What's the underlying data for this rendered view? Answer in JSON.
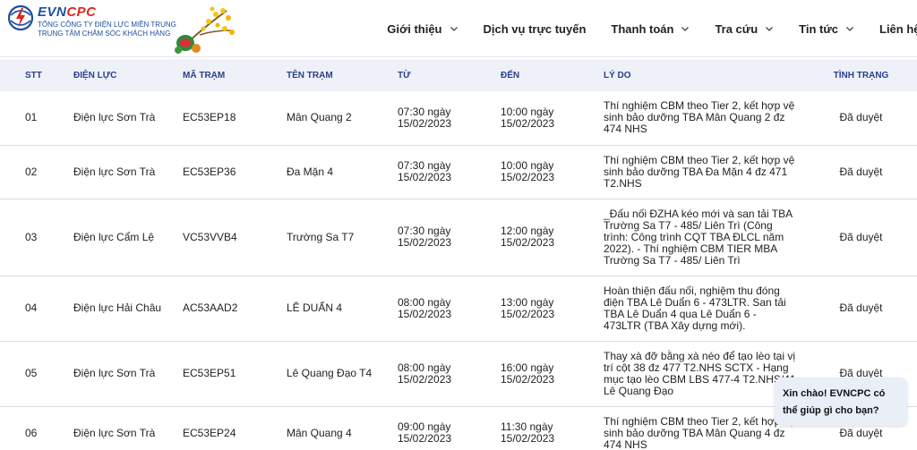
{
  "header": {
    "brand_evn": "EVN",
    "brand_cpc": "CPC",
    "company_line1": "TỔNG CÔNG TY ĐIỆN LỰC MIỀN TRUNG",
    "company_line2": "TRUNG TÂM CHĂM SÓC KHÁCH HÀNG",
    "nav": [
      {
        "label": "Giới thiệu",
        "has_dropdown": true
      },
      {
        "label": "Dịch vụ trực tuyến",
        "has_dropdown": false
      },
      {
        "label": "Thanh toán",
        "has_dropdown": true
      },
      {
        "label": "Tra cứu",
        "has_dropdown": true
      },
      {
        "label": "Tin tức",
        "has_dropdown": true
      },
      {
        "label": "Liên hệ",
        "has_dropdown": false
      }
    ]
  },
  "table": {
    "columns": [
      "STT",
      "Điện lực",
      "Mã trạm",
      "Tên trạm",
      "Từ",
      "Đến",
      "Lý do",
      "Tình trạng"
    ],
    "rows": [
      {
        "stt": "01",
        "dien_luc": "Điện lực Sơn Trà",
        "ma_tram": "EC53EP18",
        "ten_tram": "Mân Quang 2",
        "tu_time": "07:30 ngày",
        "tu_date": "15/02/2023",
        "den_time": "10:00 ngày",
        "den_date": "15/02/2023",
        "ly_do": "Thí nghiệm CBM theo Tier 2, kết hợp vệ sinh bảo dưỡng TBA Mân Quang 2 đz 474 NHS",
        "tinh_trang": "Đã duyệt"
      },
      {
        "stt": "02",
        "dien_luc": "Điện lực Sơn Trà",
        "ma_tram": "EC53EP36",
        "ten_tram": "Đa Mặn 4",
        "tu_time": "07:30 ngày",
        "tu_date": "15/02/2023",
        "den_time": "10:00 ngày",
        "den_date": "15/02/2023",
        "ly_do": "Thí nghiệm CBM theo Tier 2, kết hợp vệ sinh bảo dưỡng TBA Đa Mặn 4 đz 471 T2.NHS",
        "tinh_trang": "Đã duyệt"
      },
      {
        "stt": "03",
        "dien_luc": "Điện lực Cẩm Lệ",
        "ma_tram": "VC53VVB4",
        "ten_tram": "Trường Sa T7",
        "tu_time": "07:30 ngày",
        "tu_date": "15/02/2023",
        "den_time": "12:00 ngày",
        "den_date": "15/02/2023",
        "ly_do": "_Đấu nối ĐZHA kéo mới và san tải TBA Trường Sa T7 - 485/ Liên Trì (Công trình: Công trình CQT TBA ĐLCL năm 2022). - Thí nghiệm CBM TIER MBA Trường Sa T7 - 485/ Liên Trì",
        "tinh_trang": "Đã duyệt"
      },
      {
        "stt": "04",
        "dien_luc": "Điện lực Hải Châu",
        "ma_tram": "AC53AAD2",
        "ten_tram": "LÊ DUẨN 4",
        "tu_time": "08:00 ngày",
        "tu_date": "15/02/2023",
        "den_time": "13:00 ngày",
        "den_date": "15/02/2023",
        "ly_do": "Hoàn thiện đấu nối, nghiệm thu đóng điện TBA Lê Duẩn 6 - 473LTR. San tải TBA Lê Duẩn 4 qua Lê Duẩn 6 - 473LTR (TBA Xây dựng mới).",
        "tinh_trang": "Đã duyệt"
      },
      {
        "stt": "05",
        "dien_luc": "Điện lực Sơn Trà",
        "ma_tram": "EC53EP51",
        "ten_tram": "Lê Quang Đạo T4",
        "tu_time": "08:00 ngày",
        "tu_date": "15/02/2023",
        "den_time": "16:00 ngày",
        "den_date": "15/02/2023",
        "ly_do": "Thay xà đỡ bằng xà néo để tạo lèo tại vị trí cột 38 đz 477 T2.NHS SCTX - Hạng mục tạo lèo CBM LBS 477-4 T2.NHS/41 Lê Quang Đạo",
        "tinh_trang": "Đã duyệt"
      },
      {
        "stt": "06",
        "dien_luc": "Điện lực Sơn Trà",
        "ma_tram": "EC53EP24",
        "ten_tram": "Mân Quang 4",
        "tu_time": "09:00 ngày",
        "tu_date": "15/02/2023",
        "den_time": "11:30 ngày",
        "den_date": "15/02/2023",
        "ly_do": "Thí nghiệm CBM theo Tier 2, kết hợp vệ sinh bảo dưỡng TBA Mân Quang 4 đz 474 NHS",
        "tinh_trang": "Đã duyệt"
      }
    ]
  },
  "chat": {
    "line1": "Xin chào! EVNCPC có",
    "line2": "thể giúp gì cho bạn?"
  },
  "colors": {
    "brand_blue": "#1e4fa0",
    "brand_red": "#e0261b",
    "header_row_bg": "#eef1f8",
    "header_text": "#2a3f8f",
    "chat_bg": "#e9eef7"
  }
}
